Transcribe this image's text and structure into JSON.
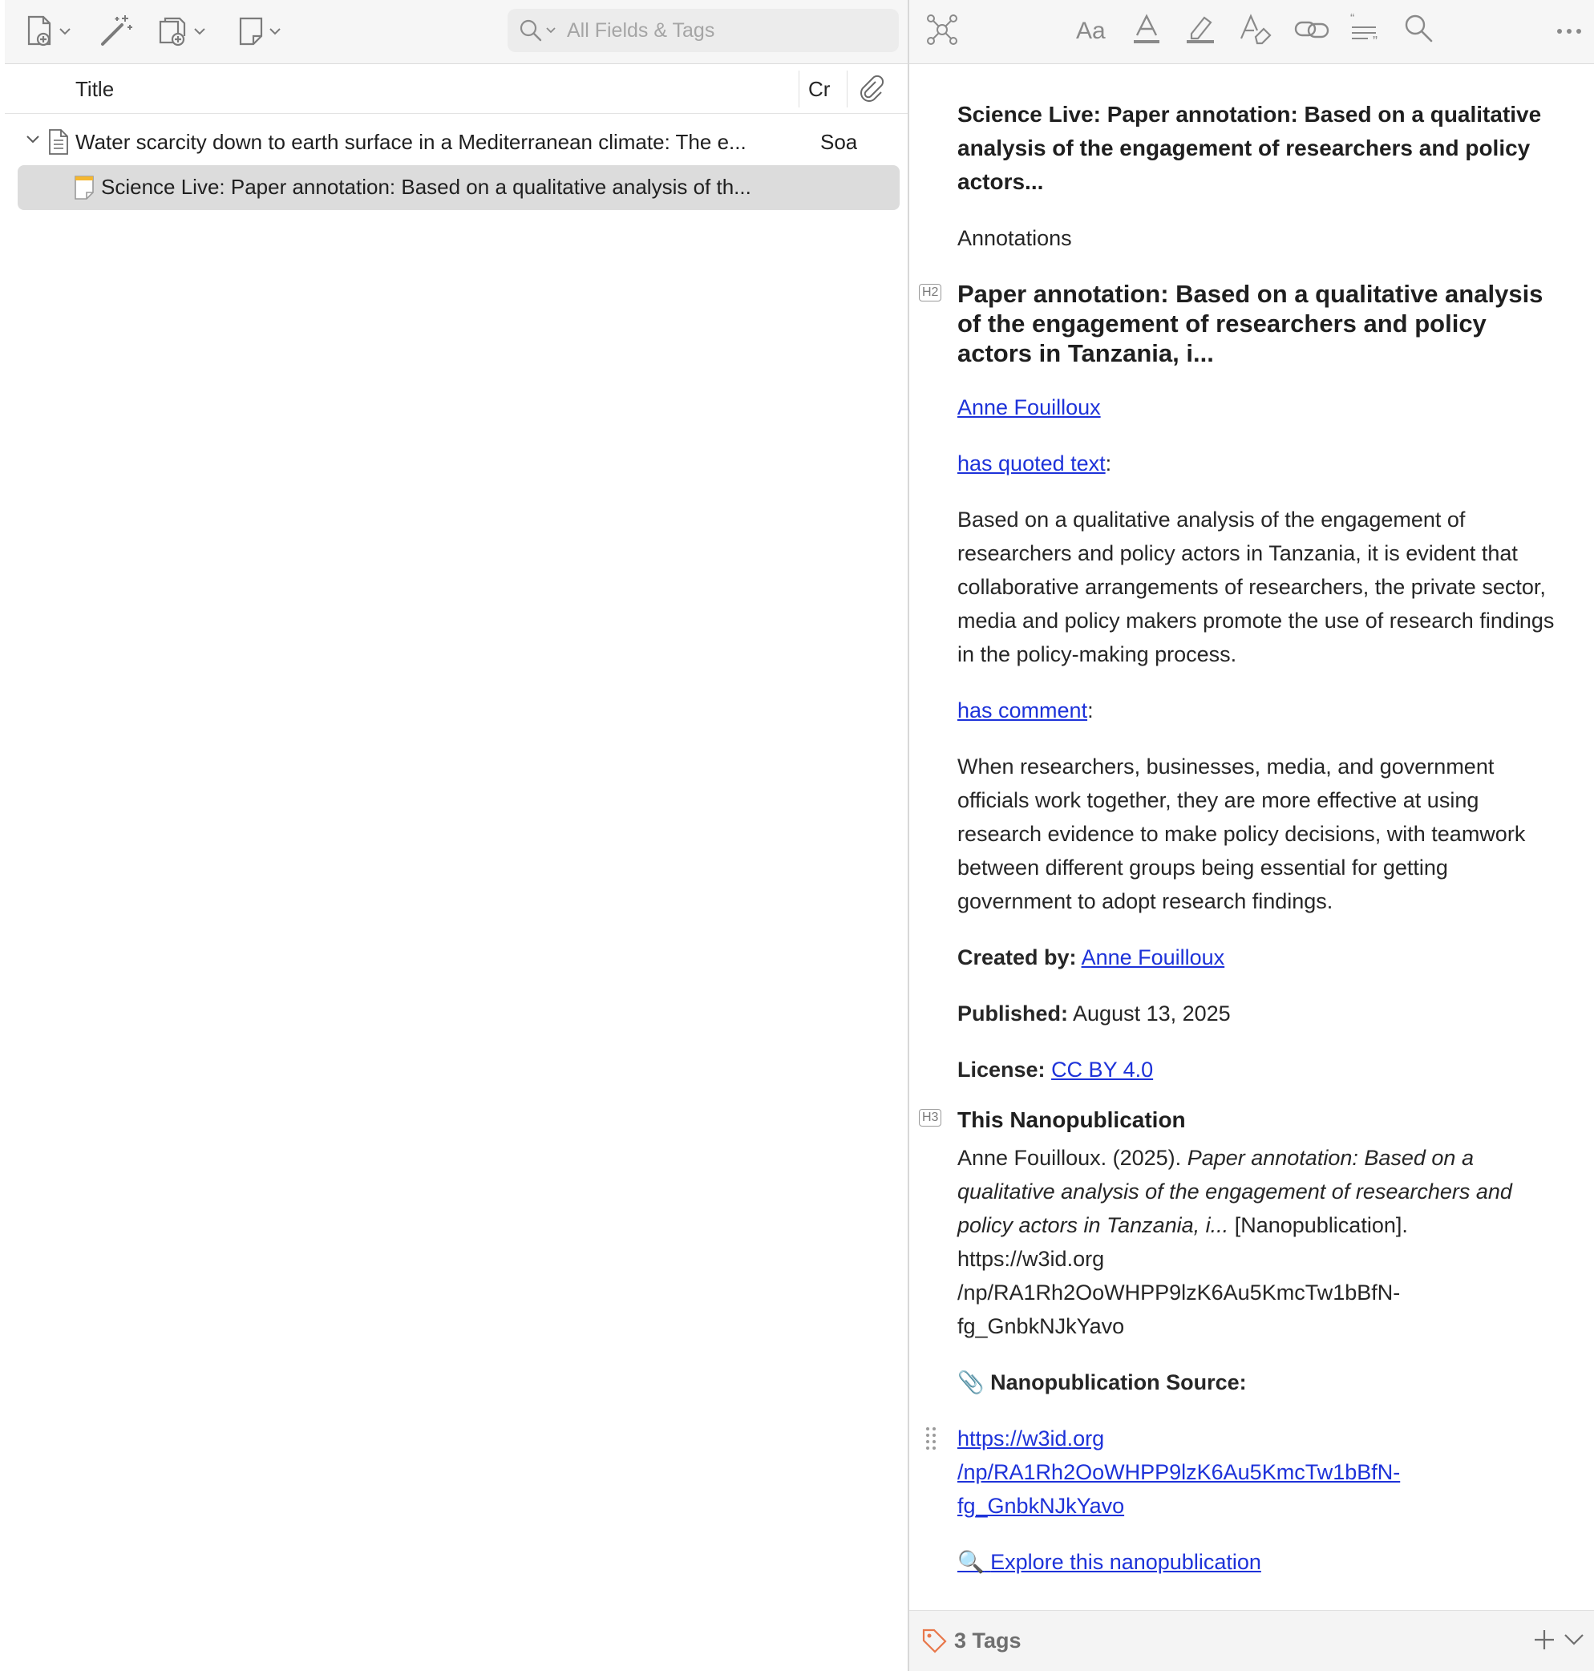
{
  "toolbar": {
    "search_placeholder": "All Fields & Tags"
  },
  "list": {
    "columns": {
      "title": "Title",
      "creator": "Cr"
    },
    "rows": [
      {
        "title": "Water scarcity down to earth surface in a Mediterranean climate: The e...",
        "creator": "Soa",
        "expanded": true
      },
      {
        "title": "Science Live: Paper annotation: Based on a qualitative analysis of th...",
        "selected": true
      }
    ]
  },
  "note": {
    "title": "Science Live: Paper annotation: Based on a qualitative analysis of the engagement of researchers and policy actors...",
    "annotations_label": "Annotations",
    "h2": "Paper annotation: Based on a qualitative analysis of the engagement of researchers and policy actors in Tanzania, i...",
    "h2_badge": "H2",
    "author_link": "Anne Fouilloux",
    "quoted_label": "has quoted text",
    "colon": ":",
    "quoted_text": "Based on a qualitative analysis of the engagement of researchers and policy actors in Tanzania, it is evident that collaborative arrangements of researchers, the private sector, media and policy makers promote the use of research findings in the policy-making process.",
    "comment_label": "has comment",
    "comment_text": "When researchers, businesses, media, and government officials work together, they are more effective at using research evidence to make policy decisions, with teamwork between different groups being essential for getting government to adopt research findings.",
    "created_by_label": "Created by:",
    "created_by_value": "Anne Fouilloux",
    "published_label": "Published:",
    "published_value": "August 13, 2025",
    "license_label": "License:",
    "license_value": "CC BY 4.0",
    "h3": "This Nanopublication",
    "h3_badge": "H3",
    "citation_author": "Anne Fouilloux. (2025).",
    "citation_title": "Paper annotation: Based on a qualitative analysis of the engagement of researchers and policy actors in Tanzania, i...",
    "citation_type": "[Nanopublication].",
    "citation_url_1": "https://w3id.org",
    "citation_url_2": "/np/RA1Rh2OoWHPP9lzK6Au5KmcTw1bBfN-",
    "citation_url_3": "fg_GnbkNJkYavo",
    "source_emoji": "📎",
    "source_label": "Nanopublication Source:",
    "source_url_1": "https://w3id.org",
    "source_url_2": "/np/RA1Rh2OoWHPP9lzK6Au5KmcTw1bBfN-",
    "source_url_3": "fg_GnbkNJkYavo",
    "explore_emoji": "🔍",
    "explore_label": "Explore this nanopublication"
  },
  "tags": {
    "label": "3 Tags",
    "accent": "#e8774a"
  },
  "colors": {
    "link": "#1d32d9",
    "selection": "#dcdcdc",
    "toolbar": "#f6f6f6"
  }
}
